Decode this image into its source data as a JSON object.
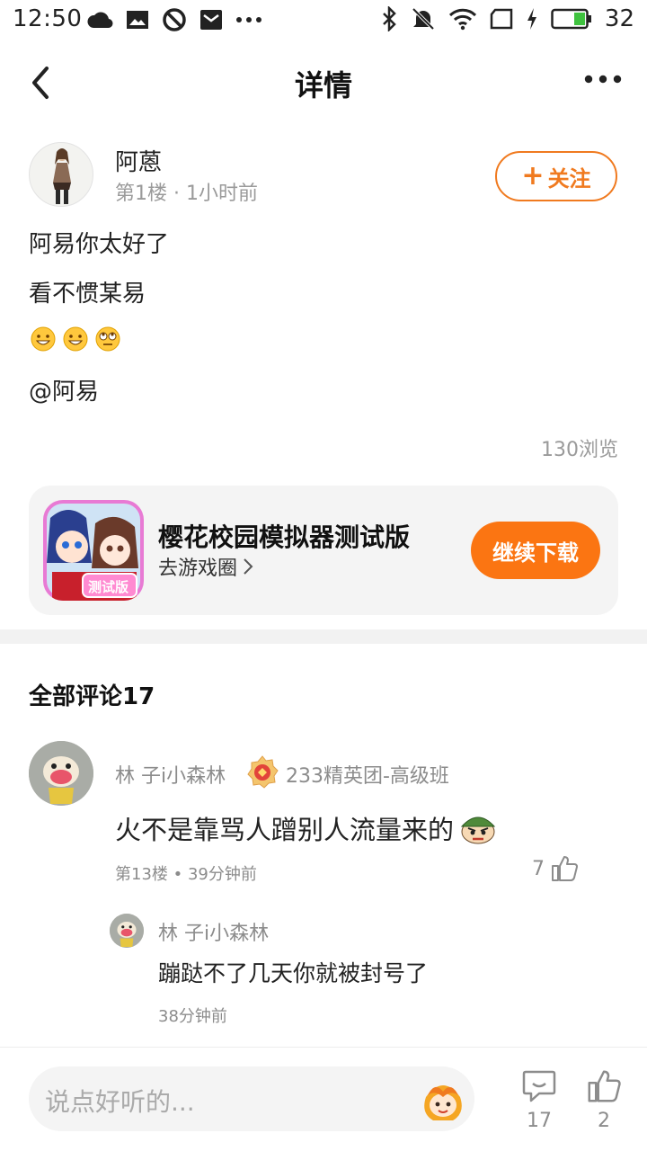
{
  "status_bar": {
    "time": "12:50",
    "battery": "32",
    "icons": [
      "weather-icon",
      "image-icon",
      "block-icon",
      "mail-icon",
      "more-icon",
      "bluetooth-icon",
      "mute-icon",
      "wifi-icon",
      "sim-icon",
      "charge-icon",
      "battery-icon"
    ]
  },
  "nav": {
    "title": "详情",
    "back_icon": "back-arrow-icon",
    "more_icon": "more-dots-icon"
  },
  "post": {
    "author": "阿蒽",
    "floor": "第1楼",
    "time": "1小时前",
    "follow_label": "关注",
    "lines": [
      "阿易你太好了",
      "看不惯某易"
    ],
    "emojis": [
      "😀",
      "😀",
      "🙄"
    ],
    "mention": "@阿易",
    "views": "130浏览"
  },
  "game": {
    "title": "樱花校园模拟器测试版",
    "link": "去游戏圈",
    "icon_badge": "测试版",
    "download_label": "继续下载"
  },
  "comments": {
    "header": "全部评论17",
    "items": [
      {
        "name": "林 子i小森林",
        "badge": "233精英团-高级班",
        "text": "火不是靠骂人蹭别人流量来的",
        "floor": "第13楼",
        "time": "39分钟前",
        "likes": "7",
        "replies": [
          {
            "name": "林 子i小森林",
            "text": "蹦跶不了几天你就被封号了",
            "time": "38分钟前"
          }
        ]
      }
    ]
  },
  "bottom_bar": {
    "placeholder": "说点好听的...",
    "comment_count": "17",
    "like_count": "2"
  },
  "colors": {
    "accent": "#fb7512",
    "follow_border": "#f07a1f",
    "muted_text": "#8c8c8c"
  }
}
